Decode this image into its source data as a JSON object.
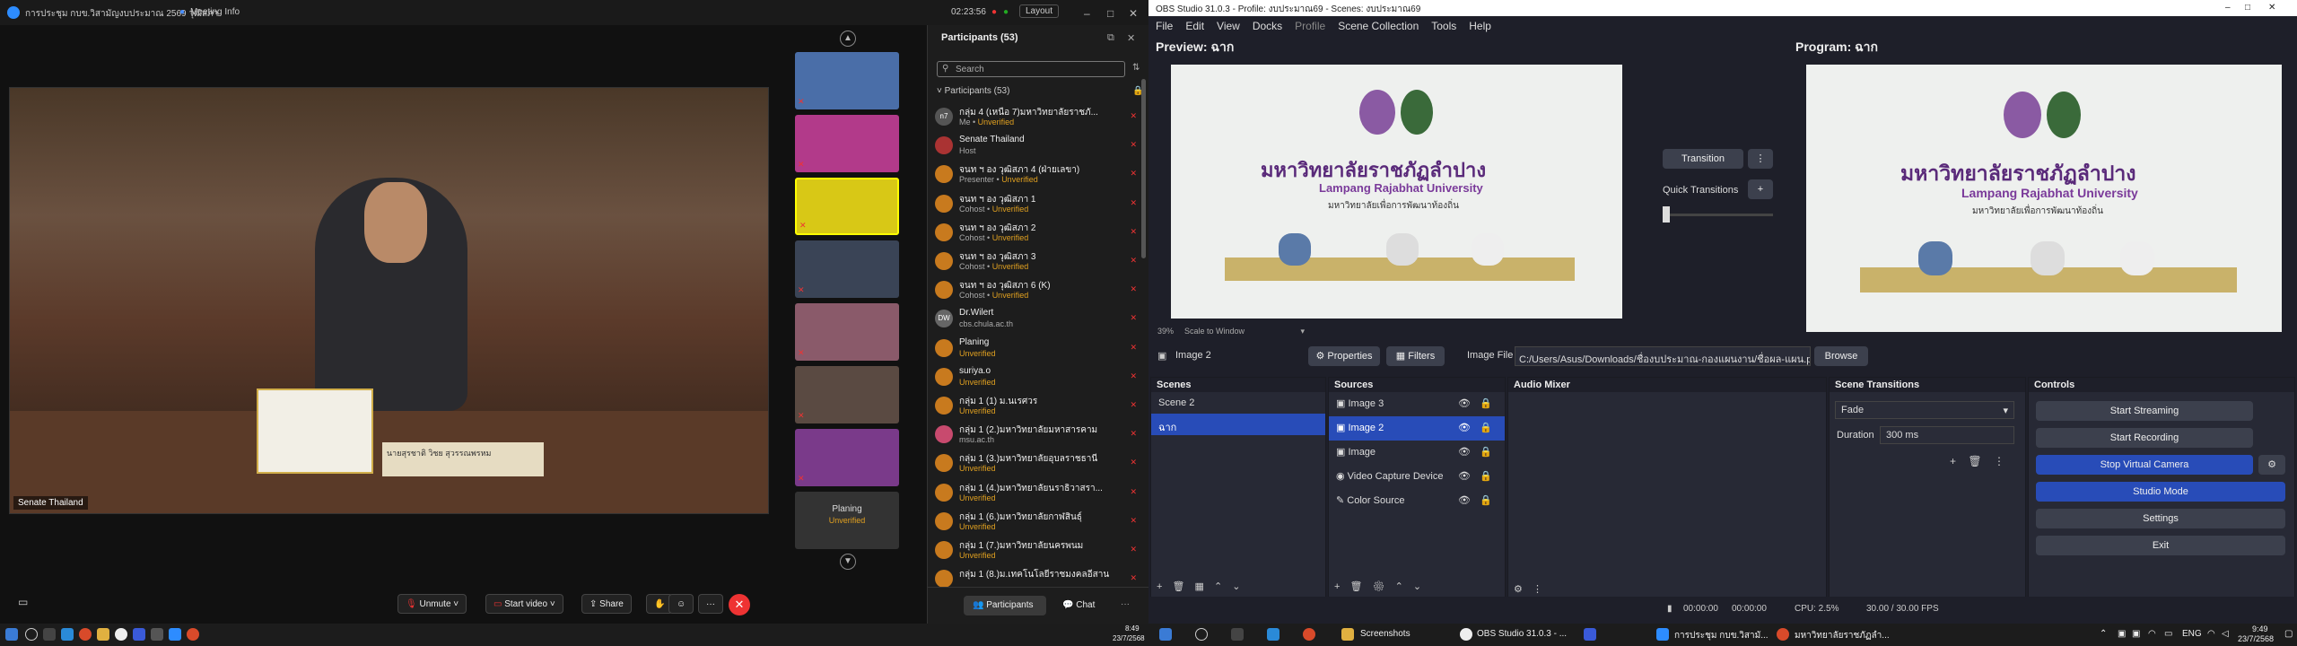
{
  "zoom": {
    "meeting_title": "การประชุม กบข.วิสามัญงบประมาณ 2569 วุฒิสภา",
    "meeting_info": "Meeting Info",
    "timer": "02:23:56",
    "layout_label": "Layout",
    "speaker_name": "Senate Thailand",
    "nameplate_text": "นายสุรชาติ วิชย สุวรรณพรหม",
    "last_tile": {
      "name": "Planing",
      "status": "Unverified"
    },
    "bottom": {
      "unmute": "Unmute",
      "start_video": "Start video",
      "share": "Share",
      "participants": "Participants",
      "chat": "Chat"
    },
    "participants": {
      "header": "Participants (53)",
      "search_placeholder": "Search",
      "sub_header": "Participants (53)",
      "list": [
        {
          "avatar": "n7",
          "name": "กลุ่ม 4 (เหนือ 7)มหาวิทยาลัยราชภั...",
          "role": "Me",
          "status": "Unverified"
        },
        {
          "avatar": "",
          "name": "Senate Thailand",
          "role": "Host",
          "status": ""
        },
        {
          "avatar": "",
          "name": "จนท ฯ อง วุฒิสภา 4 (ฝ่ายเลขา)",
          "role": "Presenter",
          "status": "Unverified"
        },
        {
          "avatar": "",
          "name": "จนท ฯ อง วุฒิสภา 1",
          "role": "Cohost",
          "status": "Unverified"
        },
        {
          "avatar": "",
          "name": "จนท ฯ อง วุฒิสภา 2",
          "role": "Cohost",
          "status": "Unverified"
        },
        {
          "avatar": "",
          "name": "จนท ฯ อง วุฒิสภา 3",
          "role": "Cohost",
          "status": "Unverified"
        },
        {
          "avatar": "",
          "name": "จนท ฯ อง วุฒิสภา 6 (K)",
          "role": "Cohost",
          "status": "Unverified"
        },
        {
          "avatar": "DW",
          "name": "Dr.Wilert",
          "role": "cbs.chula.ac.th",
          "status": ""
        },
        {
          "avatar": "",
          "name": "Planing",
          "role": "",
          "status": "Unverified"
        },
        {
          "avatar": "",
          "name": "suriya.o",
          "role": "",
          "status": "Unverified"
        },
        {
          "avatar": "",
          "name": "กลุ่ม 1 (1) ม.นเรศวร",
          "role": "",
          "status": "Unverified"
        },
        {
          "avatar": "",
          "name": "กลุ่ม 1 (2.)มหาวิทยาลัยมหาสารคาม",
          "role": "msu.ac.th",
          "status": ""
        },
        {
          "avatar": "",
          "name": "กลุ่ม 1 (3.)มหาวิทยาลัยอุบลราชธานี",
          "role": "",
          "status": "Unverified"
        },
        {
          "avatar": "",
          "name": "กลุ่ม 1 (4.)มหาวิทยาลัยนราธิวาสรา...",
          "role": "",
          "status": "Unverified"
        },
        {
          "avatar": "",
          "name": "กลุ่ม 1 (6.)มหาวิทยาลัยกาฬสินธุ์",
          "role": "",
          "status": "Unverified"
        },
        {
          "avatar": "",
          "name": "กลุ่ม 1 (7.)มหาวิทยาลัยนครพนม",
          "role": "",
          "status": "Unverified"
        },
        {
          "avatar": "",
          "name": "กลุ่ม 1 (8.)ม.เทคโนโลยีราชมงคลอีสาน",
          "role": "",
          "status": ""
        }
      ]
    }
  },
  "obs": {
    "title": "OBS Studio 31.0.3 - Profile: งบประมาณ69 - Scenes: งบประมาณ69",
    "menu": [
      "File",
      "Edit",
      "View",
      "Docks",
      "Profile",
      "Scene Collection",
      "Tools",
      "Help"
    ],
    "preview_label": "Preview: ฉาก",
    "program_label": "Program: ฉาก",
    "zoom_label": "39%",
    "scale_label": "Scale to Window",
    "transition_btn": "Transition",
    "quick_transitions": "Quick Transitions",
    "source_name": "Image 2",
    "properties_btn": "Properties",
    "filters_btn": "Filters",
    "image_file_label": "Image File",
    "image_file_path": "C:/Users/Asus/Downloads/ชื่องบประมาณ-กองแผนงาน/ชื่อผล-แผน.png",
    "browse_btn": "Browse",
    "uni_thai": "มหาวิทยาลัยราชภัฏลำปาง",
    "uni_en": "Lampang Rajabhat University",
    "uni_slogan": "มหาวิทยาลัยเพื่อการพัฒนาท้องถิ่น",
    "scenes": {
      "title": "Scenes",
      "items": [
        "Scene 2",
        "ฉาก"
      ]
    },
    "sources": {
      "title": "Sources",
      "items": [
        "Image 3",
        "Image 2",
        "Image",
        "Video Capture Device",
        "Color Source"
      ]
    },
    "mixer_title": "Audio Mixer",
    "transitions": {
      "title": "Scene Transitions",
      "type": "Fade",
      "duration_label": "Duration",
      "duration": "300 ms"
    },
    "controls": {
      "title": "Controls",
      "items": [
        "Start Streaming",
        "Start Recording",
        "Stop Virtual Camera",
        "Studio Mode",
        "Settings",
        "Exit"
      ]
    },
    "status": {
      "time1": "00:00:00",
      "time2": "00:00:00",
      "cpu": "CPU: 2.5%",
      "fps": "30.00 / 30.00 FPS"
    }
  },
  "taskbar": {
    "zoom_clock": "8:49",
    "zoom_date": "23/7/2568",
    "apps": [
      "Screenshots",
      "OBS Studio 31.0.3 - ...",
      "การประชุม กบข.วิสามั...",
      "มหาวิทยาลัยราชภัฏลำ..."
    ],
    "lang": "ENG",
    "clock": "9:49",
    "date": "23/7/2568"
  },
  "colors": {
    "obs_bg": "#1e1f29",
    "obs_accent": "#284cb8",
    "zoom_bg": "#111111",
    "unverified": "#e0a020",
    "mute_red": "#e33333"
  }
}
